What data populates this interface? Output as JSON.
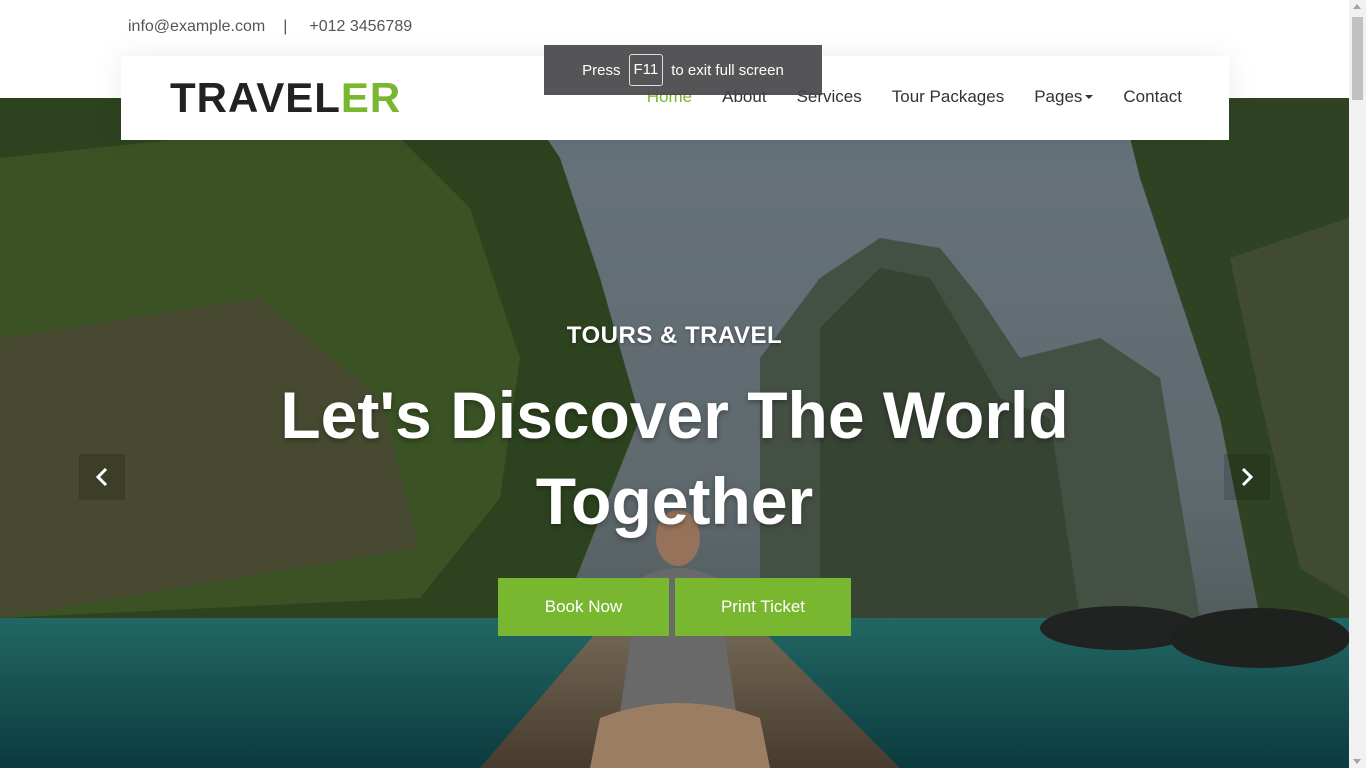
{
  "topbar": {
    "email": "info@example.com",
    "separator": "|",
    "phone": "+012 3456789"
  },
  "navbar": {
    "brand_main": "TRAVEL",
    "brand_accent": "ER",
    "items": [
      {
        "label": "Home",
        "active": true
      },
      {
        "label": "About"
      },
      {
        "label": "Services"
      },
      {
        "label": "Tour Packages"
      },
      {
        "label": "Pages",
        "dropdown": true
      },
      {
        "label": "Contact"
      }
    ]
  },
  "fullscreen_notice": {
    "press": "Press",
    "key": "F11",
    "message": "to exit full screen"
  },
  "hero": {
    "eyebrow": "TOURS & TRAVEL",
    "title": "Let's Discover The World Together",
    "book_button": "Book Now",
    "print_button": "Print Ticket",
    "prev_icon": "chevron-left-icon",
    "next_icon": "chevron-right-icon"
  },
  "colors": {
    "accent": "#7ab730",
    "text_dark": "#222222",
    "notice_bg": "#46464a"
  }
}
